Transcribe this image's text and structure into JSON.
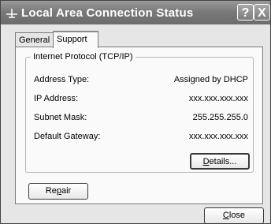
{
  "window": {
    "title": "Local Area Connection Status",
    "help_label": "?",
    "close_label": "X"
  },
  "tabs": [
    {
      "label": "General",
      "active": false
    },
    {
      "label": "Support",
      "active": true
    }
  ],
  "group": {
    "legend": "Internet Protocol (TCP/IP)",
    "rows": [
      {
        "label": "Address Type:",
        "value": "Assigned by DHCP"
      },
      {
        "label": "IP Address:",
        "value": "xxx.xxx.xxx.xxx"
      },
      {
        "label": "Subnet Mask:",
        "value": "255.255.255.0"
      },
      {
        "label": "Default Gateway:",
        "value": "xxx.xxx.xxx.xxx"
      }
    ]
  },
  "buttons": {
    "details": {
      "pre": "",
      "accel": "D",
      "post": "etails..."
    },
    "repair": {
      "pre": "Re",
      "accel": "p",
      "post": "air"
    },
    "close": {
      "pre": "",
      "accel": "C",
      "post": "lose"
    }
  },
  "colors": {
    "titlebar": "#7a7a7a",
    "face": "#e6e6e6",
    "panel": "#fafafa"
  }
}
